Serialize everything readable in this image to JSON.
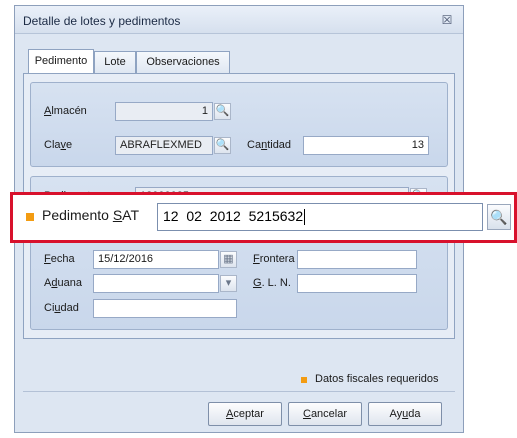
{
  "window": {
    "title": "Detalle de lotes y pedimentos",
    "close_glyph": "☒"
  },
  "tabs": [
    {
      "label": "Pedimento",
      "active": true
    },
    {
      "label": "Lote",
      "active": false
    },
    {
      "label": "Observaciones",
      "active": false
    }
  ],
  "stock": {
    "almacen_label_pre": "",
    "almacen_label_ul": "A",
    "almacen_label_post": "lmacén",
    "almacen_value": "1",
    "clave_label_pre": "Cla",
    "clave_label_ul": "v",
    "clave_label_post": "e",
    "clave_value": "ABRAFLEXMED",
    "cantidad_label_pre": "Ca",
    "cantidad_label_ul": "n",
    "cantidad_label_post": "tidad",
    "cantidad_value": "13"
  },
  "pedimento": {
    "pedimento_label_pre": "",
    "pedimento_label_ul": "P",
    "pedimento_label_post": "edimento",
    "pedimento_value": "12000025a",
    "sat_label_pre": "Pedimento ",
    "sat_label_ul": "S",
    "sat_label_post": "AT",
    "sat_value": "12  02  2012  5215632",
    "fecha_label_pre": "",
    "fecha_label_ul": "F",
    "fecha_label_post": "echa",
    "fecha_value": "15/12/2016",
    "frontera_label_pre": "",
    "frontera_label_ul": "F",
    "frontera_label_post": "rontera",
    "frontera_value": "",
    "aduana_label_pre": "A",
    "aduana_label_ul": "d",
    "aduana_label_post": "uana",
    "aduana_value": "",
    "gln_label_pre": "",
    "gln_label_ul": "G",
    "gln_label_post": ". L. N.",
    "gln_value": "",
    "ciudad_label_pre": "Ci",
    "ciudad_label_ul": "u",
    "ciudad_label_post": "dad",
    "ciudad_value": ""
  },
  "legend": {
    "text": "Datos fiscales requeridos",
    "color": "#f39c12"
  },
  "buttons": {
    "accept_pre": "",
    "accept_ul": "A",
    "accept_post": "ceptar",
    "cancel_pre": "",
    "cancel_ul": "C",
    "cancel_post": "ancelar",
    "help_pre": "Ay",
    "help_ul": "u",
    "help_post": "da"
  },
  "icons": {
    "search": "🔍",
    "calendar": "▦",
    "dropdown": "▾"
  }
}
